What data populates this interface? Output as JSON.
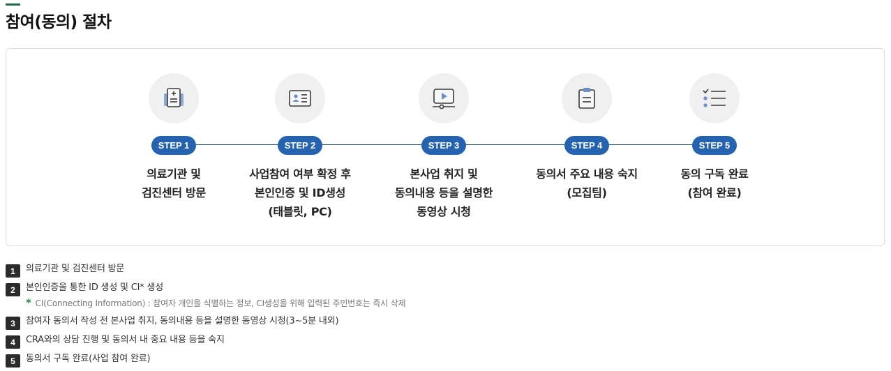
{
  "page": {
    "title": "참여(동의) 절차"
  },
  "steps": [
    {
      "badge": "STEP 1",
      "label": "의료기관 및\n검진센터 방문",
      "icon": "clipboard-plus-icon"
    },
    {
      "badge": "STEP 2",
      "label": "사업참여 여부 확정 후\n본인인증 및 ID생성\n(태블릿, PC)",
      "icon": "id-card-icon"
    },
    {
      "badge": "STEP 3",
      "label": "본사업 취지 및\n동의내용 등을 설명한\n동영상 시청",
      "icon": "video-play-icon"
    },
    {
      "badge": "STEP 4",
      "label": "동의서 주요 내용 숙지\n(모집팀)",
      "icon": "clipboard-icon"
    },
    {
      "badge": "STEP 5",
      "label": "동의 구독 완료\n(참여 완료)",
      "icon": "checklist-icon"
    }
  ],
  "notes": [
    {
      "num": "1",
      "text": "의료기관 및 검진센터 방문"
    },
    {
      "num": "2",
      "text": "본인인증을 통한 ID 생성 및 CI* 생성",
      "sub": "CI(Connecting Information) : 참여자 개인을 식별하는 정보, CI생성을 위해 입력된 주민번호는 즉시 삭제",
      "sub_mark": "*"
    },
    {
      "num": "3",
      "text": "참여자 동의서 작성 전 본사업 취지, 동의내용 등을 설명한 동영상 시청(3~5분 내외)"
    },
    {
      "num": "4",
      "text": "CRA와의 상담 진행 및 동의서 내 중요 내용 등을 숙지"
    },
    {
      "num": "5",
      "text": "동의서 구독 완료(사업 참여 완료)"
    }
  ],
  "colors": {
    "accent": "#1e6b45",
    "badge": "#2563b0",
    "line": "#1a4d6d",
    "icon_stroke": "#3a3a3a",
    "icon_fill": "#6b8fc7"
  }
}
